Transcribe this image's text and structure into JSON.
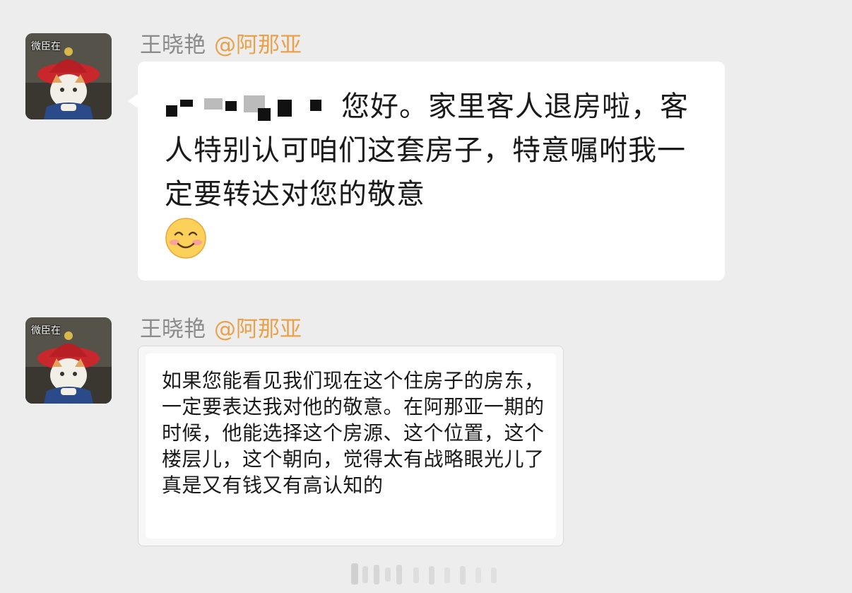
{
  "messages": [
    {
      "sender": "王晓艳",
      "mention": "@阿那亚",
      "avatar_tag": "微臣在",
      "text": "您好。家里客人退房啦，客人特别认可咱们这套房子，特意嘱咐我一定要转达对您的敬意",
      "emoji": "smiling-face"
    },
    {
      "sender": "王晓艳",
      "mention": "@阿那亚",
      "avatar_tag": "微臣在",
      "screenshot_text": "如果您能看见我们现在这个住房子的房东，一定要表达我对他的敬意。在阿那亚一期的时候，他能选择这个房源、这个位置，这个楼层儿，这个朝向，觉得太有战略眼光儿了 真是又有钱又有高认知的"
    }
  ],
  "colors": {
    "background": "#ededed",
    "sender": "#8a8a8a",
    "mention": "#e7a24b",
    "bubble": "#ffffff"
  }
}
